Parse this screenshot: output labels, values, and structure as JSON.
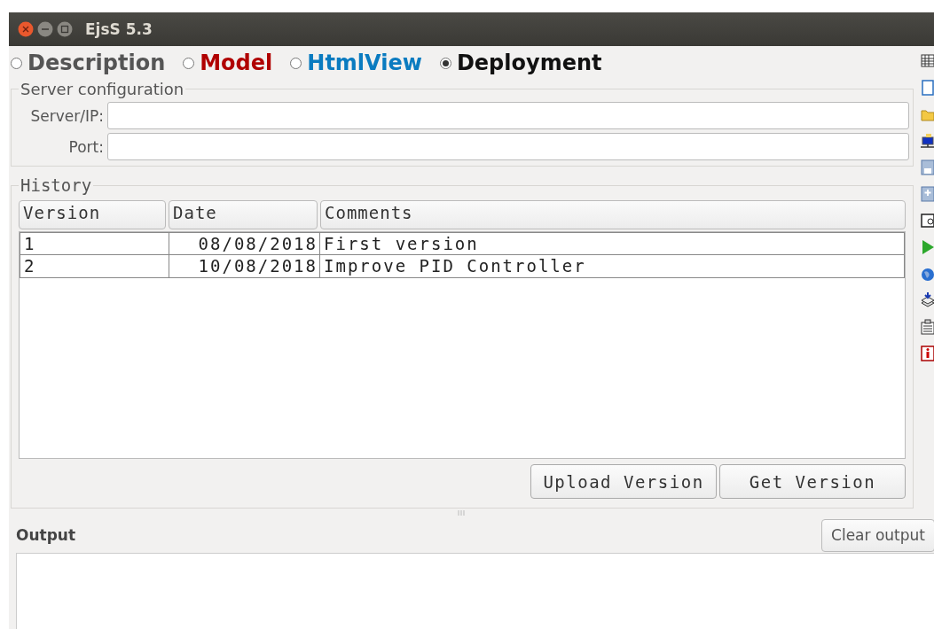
{
  "window": {
    "title": "EjsS 5.3"
  },
  "tabs": [
    {
      "label": "Description",
      "selected": false,
      "color": "#555555"
    },
    {
      "label": "Model",
      "selected": false,
      "color": "#b00000"
    },
    {
      "label": "HtmlView",
      "selected": false,
      "color": "#0a7bc0"
    },
    {
      "label": "Deployment",
      "selected": true,
      "color": "#111111"
    }
  ],
  "server": {
    "legend": "Server configuration",
    "fields": [
      {
        "label": "Server/IP:"
      },
      {
        "label": "Port:"
      }
    ]
  },
  "history": {
    "legend": "History",
    "columns": [
      "Version",
      "Date",
      "Comments"
    ],
    "rows": [
      [
        "1",
        "08/08/2018",
        "First version"
      ],
      [
        "2",
        "10/08/2018",
        "Improve PID Controller"
      ]
    ],
    "buttons": [
      "Upload Version",
      "Get Version"
    ]
  },
  "output": {
    "label": "Output",
    "clear_button": "Clear output"
  }
}
